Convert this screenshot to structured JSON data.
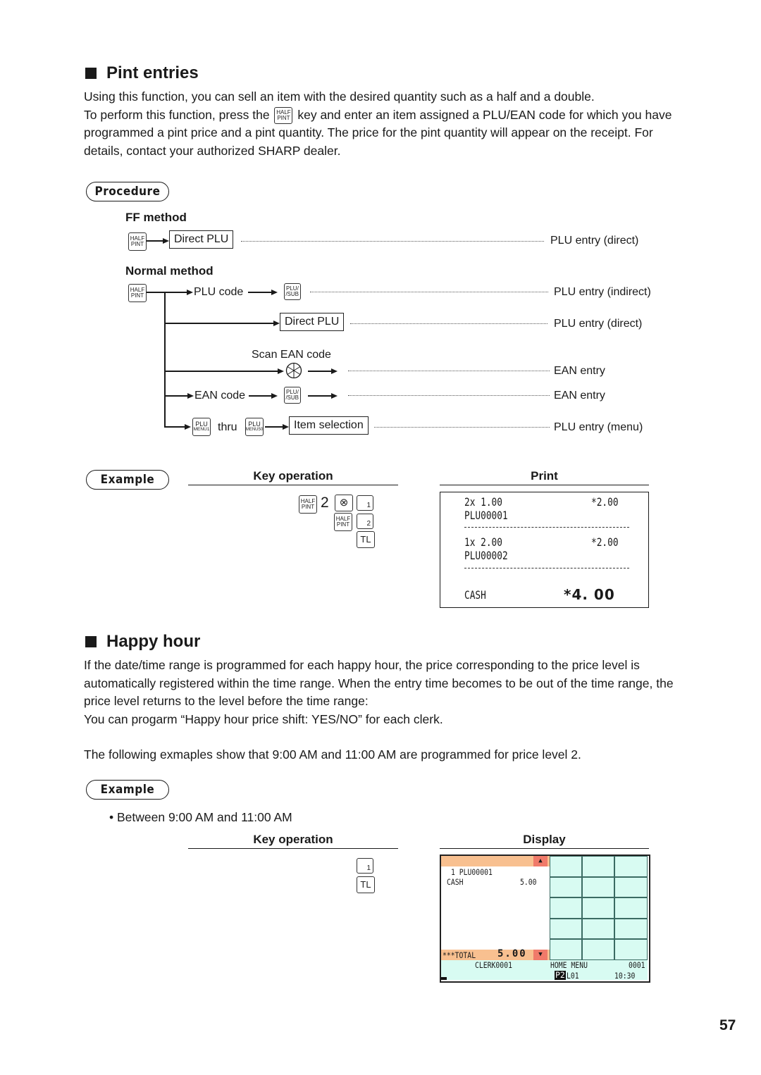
{
  "pint_section": {
    "title": "Pint entries",
    "paragraph_line1": "Using this function, you can sell an item with the desired quantity such as a half and a double.",
    "paragraph_line2_pre": "To perform this function, press the",
    "paragraph_line2_post": "key and enter an item assigned a PLU/EAN code for which you have",
    "paragraph_line3": "programmed a pint price and a pint quantity. The price for the pint quantity will appear on the receipt. For",
    "paragraph_line4": "details, contact your authorized SHARP dealer.",
    "procedure_label": "Procedure",
    "ff_method": {
      "title": "FF method",
      "box": "Direct PLU",
      "result": "PLU entry (direct)"
    },
    "normal_method": {
      "title": "Normal method",
      "plu_code_label": "PLU code",
      "result_indirect": "PLU entry (indirect)",
      "direct_box": "Direct PLU",
      "result_direct": "PLU entry (direct)",
      "scan_label": "Scan EAN code",
      "result_ean_scan": "EAN entry",
      "ean_code_label": "EAN code",
      "result_ean_code": "EAN entry",
      "thru_label": "thru",
      "item_selection_box": "Item selection",
      "result_menu": "PLU entry (menu)"
    },
    "keys": {
      "half_pint_top": "HALF",
      "half_pint_bottom": "PINT",
      "plu_sub_top": "PLU/",
      "plu_sub_bottom": "/SUB",
      "plu_menu1_top": "PLU",
      "plu_menu1_bottom": "MENU1",
      "plu_menu50_top": "PLU",
      "plu_menu50_bottom": "MENU50",
      "multiply_symbol": "⊗",
      "num1": "1",
      "num2": "2",
      "tl": "TL"
    },
    "example": {
      "label": "Example",
      "key_operation_header": "Key operation",
      "print_header": "Print",
      "typed_quantity": "2",
      "receipt": {
        "line1_left": "2x 1.00",
        "line1_right": "*2.00",
        "line2": "PLU00001",
        "line3_left": "1x 2.00",
        "line3_right": "*2.00",
        "line4": "PLU00002",
        "cash_label": "CASH",
        "cash_value": "*4. 00"
      }
    }
  },
  "happy_section": {
    "title": "Happy hour",
    "paragraph_line1": "If the date/time range is programmed for each happy hour, the price corresponding to the price level is",
    "paragraph_line2": "automatically registered within the time range. When the entry time becomes to be out of the time range, the",
    "paragraph_line3": "price level returns to the level before the time range:",
    "paragraph_line4": "You can progarm “Happy hour price shift: YES/NO” for each clerk.",
    "paragraph_line5": "The following exmaples show that 9:00 AM and 11:00 AM are programmed for price level 2.",
    "example": {
      "label": "Example",
      "bullet": "• Between 9:00 AM and 11:00 AM",
      "key_operation_header": "Key operation",
      "display_header": "Display",
      "keys": {
        "num1": "1",
        "tl": "TL"
      },
      "display": {
        "item_line": "1 PLU00001",
        "cash_label": "CASH",
        "cash_value": "5.00",
        "total_label": "***TOTAL",
        "total_value": "5.00",
        "clerk": "CLERK0001",
        "menu": "HOME MENU",
        "number": "0001",
        "price_level_badge": "P2",
        "price_level_rest": "L01",
        "time": "10:30",
        "colors": {
          "header_orange": "#f8c090",
          "scroll_red": "#f07a6a",
          "mint": "#d8fbf2"
        }
      }
    }
  },
  "page_number": "57"
}
